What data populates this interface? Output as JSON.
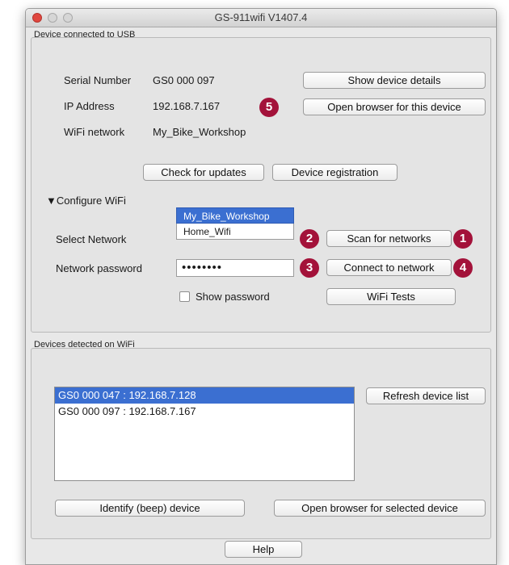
{
  "window": {
    "title": "GS-911wifi V1407.4"
  },
  "usb": {
    "group_label": "Device connected to USB",
    "serial_label": "Serial Number",
    "serial_value": "GS0 000 097",
    "ip_label": "IP Address",
    "ip_value": "192.168.7.167",
    "wifi_label": "WiFi network",
    "wifi_value": "My_Bike_Workshop",
    "show_details": "Show device details",
    "open_browser": "Open browser for this device",
    "check_updates": "Check for updates",
    "registration": "Device registration"
  },
  "wifi": {
    "toggle": "▼Configure WiFi",
    "select_label": "Select Network",
    "options": [
      "My_Bike_Workshop",
      "Home_Wifi"
    ],
    "selected_option": "My_Bike_Workshop",
    "scan": "Scan for networks",
    "password_label": "Network password",
    "password_value": "••••••••",
    "connect": "Connect to network",
    "show_password": "Show password",
    "tests": "WiFi Tests"
  },
  "devices": {
    "group_label": "Devices detected on WiFi",
    "items": [
      "GS0 000 047 : 192.168.7.128",
      "GS0 000 097 : 192.168.7.167"
    ],
    "selected_index": 0,
    "refresh": "Refresh device list",
    "identify": "Identify (beep) device",
    "open_selected": "Open browser for selected device"
  },
  "help": "Help",
  "callouts": {
    "scan": "1",
    "select": "2",
    "password": "3",
    "connect": "4",
    "browser": "5"
  },
  "colors": {
    "badge": "#a3123a",
    "selection": "#3b6fd1",
    "close_button": "#e0473f"
  }
}
